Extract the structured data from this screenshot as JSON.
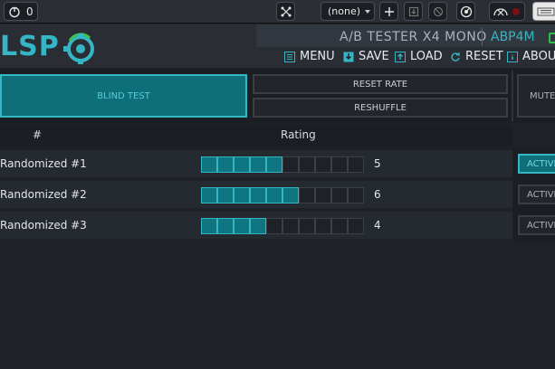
{
  "system_bar": {
    "counter_value": "0",
    "preset_value": "(none)"
  },
  "header": {
    "logo_text": "LSP",
    "plugin_name": "A/B TESTER X4 MONO",
    "plugin_code": "ABP4M",
    "menu": [
      {
        "label": "MENU",
        "icon": "menu-icon"
      },
      {
        "label": "SAVE",
        "icon": "save-icon"
      },
      {
        "label": "LOAD",
        "icon": "load-icon"
      },
      {
        "label": "RESET",
        "icon": "reset-icon"
      },
      {
        "label": "ABOU",
        "icon": "info-icon"
      }
    ]
  },
  "controls": {
    "blind_test_label": "BLIND TEST",
    "reset_rate_label": "RESET RATE",
    "reshuffle_label": "RESHUFFLE",
    "mute_label": "MUTE"
  },
  "table": {
    "col_number": "#",
    "col_rating": "Rating",
    "max_rating": 10,
    "rows": [
      {
        "label": "Randomized #1",
        "rating": 5,
        "rating_text": "5",
        "active_label": "ACTIVE",
        "active": true
      },
      {
        "label": "Randomized #2",
        "rating": 6,
        "rating_text": "6",
        "active_label": "ACTIVE",
        "active": false
      },
      {
        "label": "Randomized #3",
        "rating": 4,
        "rating_text": "4",
        "active_label": "ACTIVE",
        "active": false
      }
    ]
  },
  "colors": {
    "accent": "#35b6c5",
    "active_fill": "#0f6f78",
    "background": "#1e2227"
  }
}
